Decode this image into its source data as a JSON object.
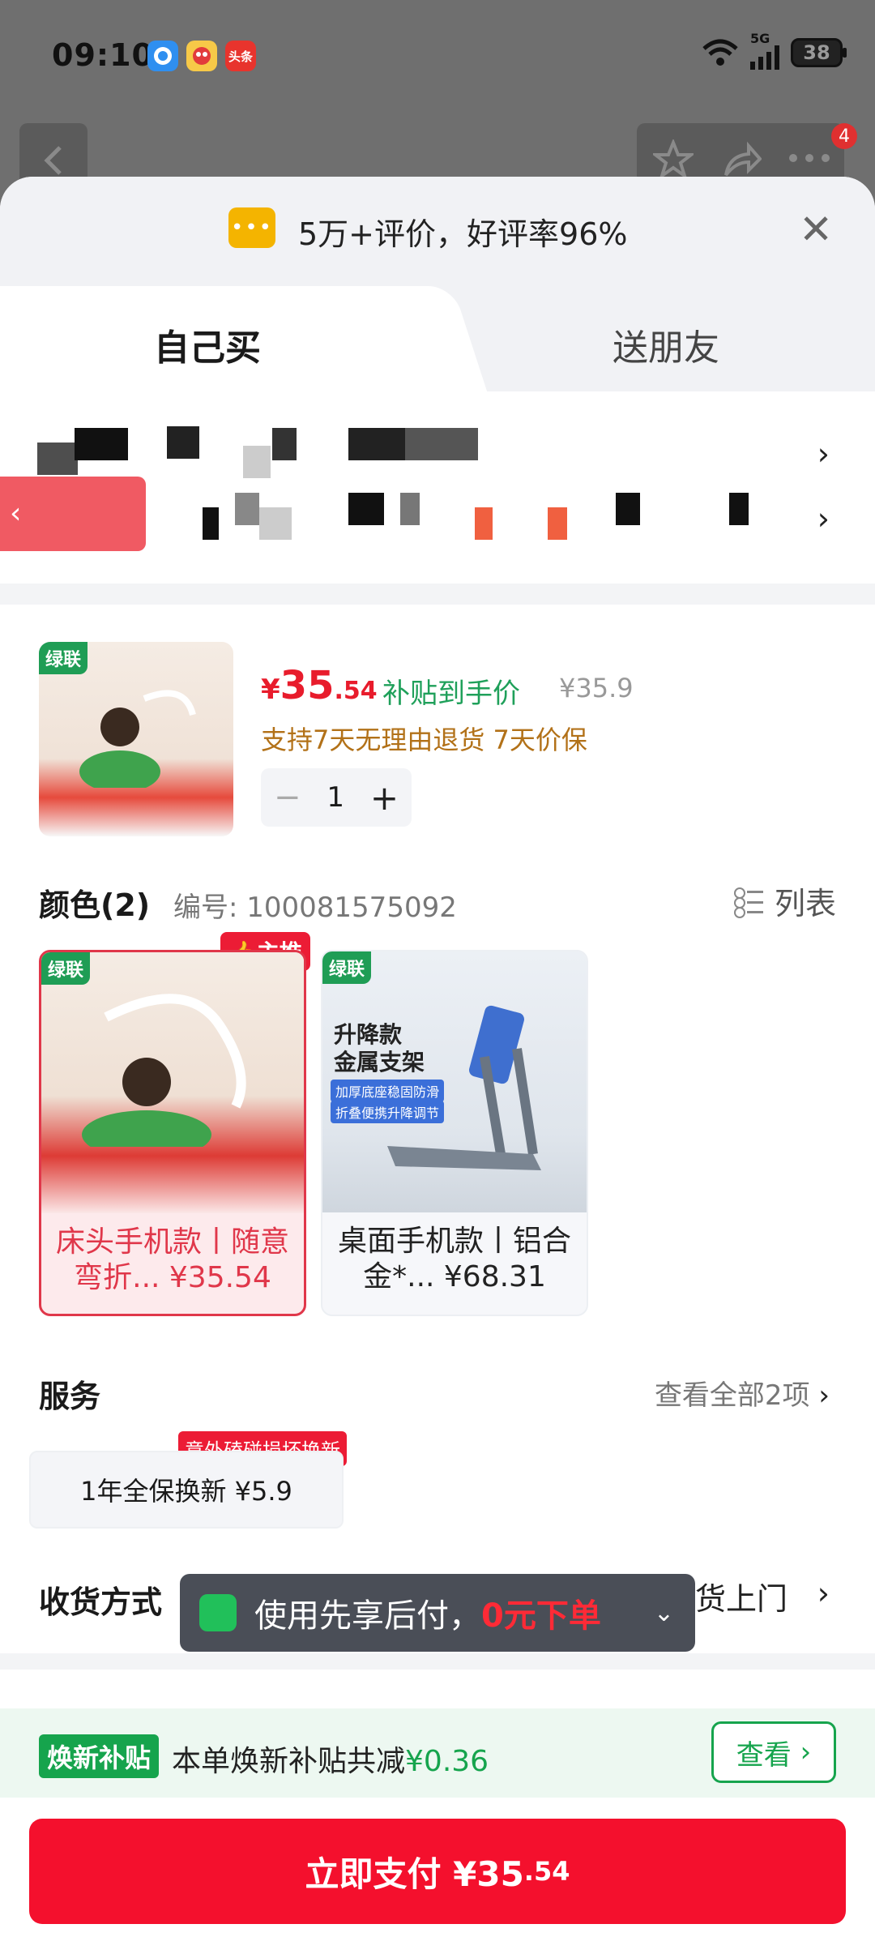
{
  "status_bar": {
    "time": "09:10",
    "network": "5G",
    "battery": "38",
    "app_icons": [
      "browser-icon",
      "game-app-icon",
      "news-app-icon"
    ],
    "news_app_label": "头条"
  },
  "background": {
    "notification_count": "4"
  },
  "sheet": {
    "rating_text": "5万+评价，好评率96%",
    "tabs": [
      {
        "label": "自己买"
      },
      {
        "label": "送朋友"
      }
    ]
  },
  "product": {
    "brand": "绿联",
    "price_symbol": "¥",
    "price_int": "35",
    "price_dec": ".54",
    "subsidy_label": "补贴到手价",
    "original_price": "¥35.9",
    "support_text": "支持7天无理由退货  7天价保",
    "quantity": "1"
  },
  "color_section": {
    "title": "颜色(2)",
    "code": "编号: 100081575092",
    "list_label": "列表",
    "hot_badge": "主推",
    "variants": [
      {
        "brand": "绿联",
        "label": "床头手机款丨随意弯折... ¥35.54"
      },
      {
        "brand": "绿联",
        "label": "桌面手机款丨铝合金*... ¥68.31",
        "img_title": "升降款\n金属支架",
        "chips": [
          "加厚底座稳固防滑",
          "折叠便携升降调节"
        ]
      }
    ]
  },
  "service_section": {
    "title": "服务",
    "more": "查看全部2项",
    "tag": "意外磕碰损坏换新",
    "card": "1年全保换新  ¥5.9"
  },
  "delivery_section": {
    "title": "收货方式",
    "value": "货上门"
  },
  "toast": {
    "text": "使用先享后付，",
    "highlight": "0元下单"
  },
  "subsidy_bar": {
    "tag": "焕新补贴",
    "text": "本单焕新补贴共减",
    "amount": "¥0.36",
    "button": "查看"
  },
  "pay": {
    "label": "立即支付 ¥35",
    "decimal": ".54"
  }
}
